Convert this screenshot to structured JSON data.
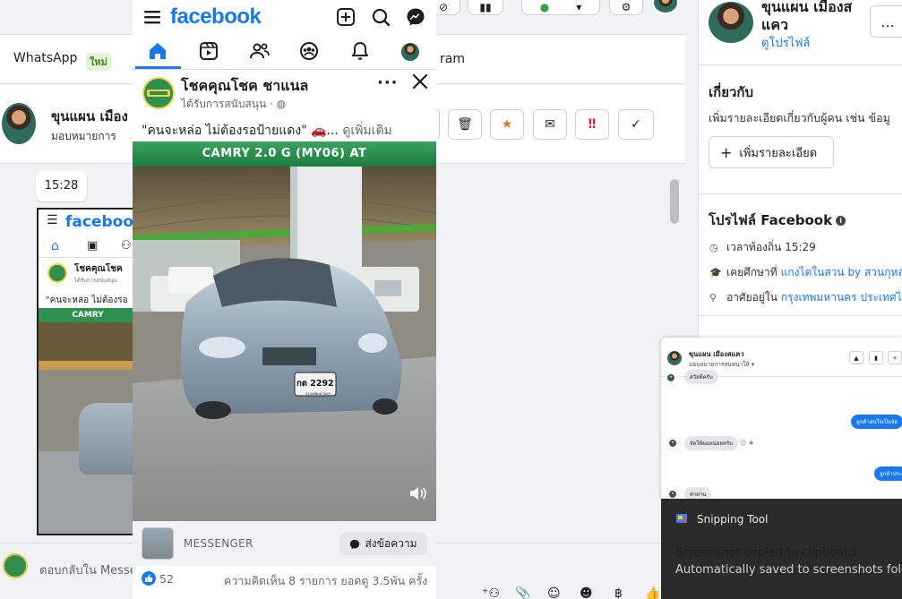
{
  "inbox": {
    "tabs": {
      "whatsapp": "WhatsApp",
      "new_badge": "ใหม่",
      "instagram_partial": "ram"
    },
    "conversation": {
      "name": "ขุนแผน เมือง",
      "subtitle": "มอบหมายการ"
    },
    "timestamp": "15:28",
    "thumbnail": {
      "brand": "facebook",
      "page_name": "โชคคุณโชค",
      "sponsored": "ได้รับการสนับสนุน",
      "quote": "\"คนจะหล่อ ไม่ต้องรอ",
      "banner": "CAMRY"
    },
    "reply_placeholder": "ตอบกลับใน Messenger...",
    "right_panel": {
      "name": "ขุนแผน เมืองสแคว",
      "profile_link": "ดูโปรไฟล์",
      "more": "...",
      "about_title": "เกี่ยวกับ",
      "about_desc": "เพิ่มรายละเอียดเกี่ยวกับผู้คน เช่น ข้อมู",
      "add_detail": "เพิ่มรายละเอียด",
      "fb_profile_title": "โปรไฟล์ Facebook",
      "local_time": "เวลาท้องถิ่น 15:29",
      "education_prefix": "เคยศึกษาที่",
      "education_link": "แกงไตในสวน by สวนกุหลาบ",
      "lives_prefix": "อาศัยอยู่ใน",
      "lives_link": "กรุงเทพมหานคร ประเทศไทย"
    },
    "mini_chat": {
      "name": "ขุนแผน เมืองสแคว",
      "subtitle": "มอบหมายการสนทนาให้",
      "messages": [
        {
          "dir": "in",
          "text": "สวัสดีครับ"
        },
        {
          "dir": "out",
          "text": "ลูกค้าสนใจเป็นจัด"
        },
        {
          "dir": "in",
          "text": "จัดให้ผมหน่อยครับ"
        },
        {
          "dir": "out",
          "text": "ลูกค้าประ"
        },
        {
          "dir": "in",
          "text": "ค่าผ่าน"
        }
      ]
    }
  },
  "toast": {
    "app": "Snipping Tool",
    "title": "Screenshot copied to clipboard",
    "body": "Automatically saved to screenshots folder"
  },
  "facebook": {
    "logo": "facebook",
    "page_name": "โชคคุณโชค ชาแนล",
    "sponsored": "ได้รับการสนับสนุน",
    "post_text": "\"คนจะหล่อ ไม่ต้องรอป้ายแดง\" 🚗...",
    "see_more": "ดูเพิ่มเติม",
    "media": {
      "banner": "CAMRY 2.0 G (MY06) AT",
      "plate": "กต 2292",
      "plate_province": "กรุงเทพมหานคร"
    },
    "messenger_label": "MESSENGER",
    "send_button": "ส่งข้อความ",
    "likes": "52",
    "comments_shares": "ความคิดเห็น 8 รายการ  ยอดดู 3.5พัน ครั้ง"
  },
  "colors": {
    "fb_blue": "#1877f2",
    "banner_green": "#2f8f4e",
    "toast_bg": "#2b2b2b"
  }
}
